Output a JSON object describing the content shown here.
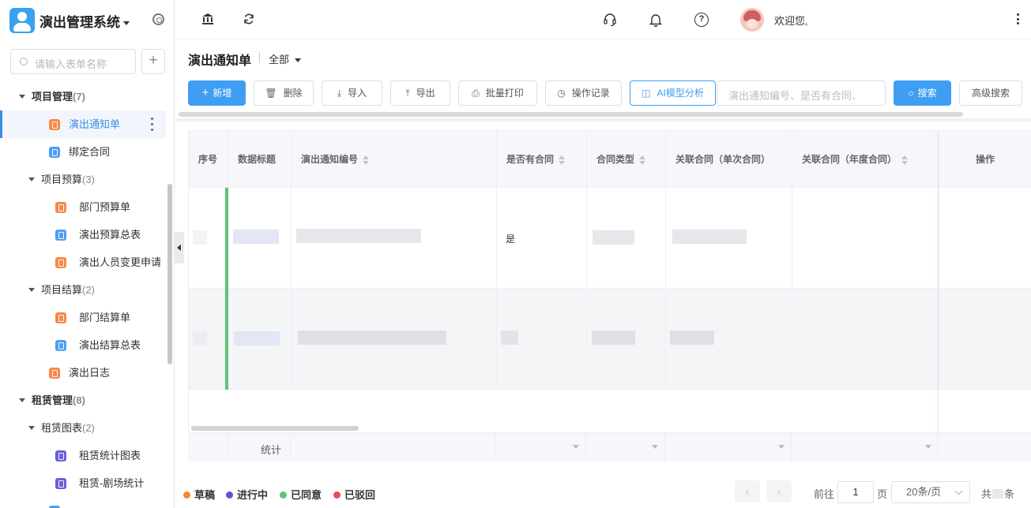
{
  "app": {
    "title": "演出管理系统"
  },
  "sidebar": {
    "search_placeholder": "请输入表单名称",
    "add_label": "+",
    "groups": [
      {
        "label": "项目管理",
        "count": "(7)"
      },
      {
        "label": "项目预算",
        "count": "(3)"
      },
      {
        "label": "项目结算",
        "count": "(2)"
      },
      {
        "label": "租赁管理",
        "count": "(8)"
      },
      {
        "label": "租赁图表",
        "count": "(2)"
      }
    ],
    "items": [
      {
        "label": "演出通知单",
        "icon": "form-icon",
        "color": "orange"
      },
      {
        "label": "绑定合同",
        "icon": "form-icon",
        "color": "blue"
      },
      {
        "label": "部门预算单",
        "icon": "form-icon",
        "color": "orange"
      },
      {
        "label": "演出预算总表",
        "icon": "report-icon",
        "color": "blue"
      },
      {
        "label": "演出人员变更申请",
        "icon": "form-icon",
        "color": "orange"
      },
      {
        "label": "部门结算单",
        "icon": "form-icon",
        "color": "orange"
      },
      {
        "label": "演出结算总表",
        "icon": "report-icon",
        "color": "blue"
      },
      {
        "label": "演出日志",
        "icon": "form-icon",
        "color": "orange"
      },
      {
        "label": "租赁统计图表",
        "icon": "chart-icon",
        "color": "purple"
      },
      {
        "label": "租赁-剧场统计",
        "icon": "chart-icon",
        "color": "purple"
      }
    ]
  },
  "header": {
    "welcome": "欢迎您,"
  },
  "page": {
    "title": "演出通知单",
    "filter": "全部"
  },
  "toolbar": {
    "add": "新增",
    "delete": "删除",
    "import": "导入",
    "export": "导出",
    "batch_print": "批量打印",
    "op_log": "操作记录",
    "ai": "AI模型分析",
    "search_placeholder": "演出通知编号、是否有合同、",
    "search": "搜索",
    "advanced": "高级搜索"
  },
  "table": {
    "headers": [
      "序号",
      "数据标题",
      "演出通知编号",
      "是否有合同",
      "合同类型",
      "关联合同（单次合同）",
      "关联合同（年度合同）",
      "操作"
    ],
    "rows": [
      {
        "has_contract": "是"
      },
      {
        "has_contract": ""
      }
    ],
    "summary_label": "统计"
  },
  "legend": [
    {
      "label": "草稿",
      "color": "#f0883a"
    },
    {
      "label": "进行中",
      "color": "#5b57d1"
    },
    {
      "label": "已同意",
      "color": "#5cc47b"
    },
    {
      "label": "已驳回",
      "color": "#ee4a52"
    }
  ],
  "pagination": {
    "goto": "前往",
    "page": "1",
    "page_unit": "页",
    "page_size": "20条/页",
    "total_prefix": "共",
    "total_suffix": "条",
    "prev": "‹",
    "next": "›"
  }
}
